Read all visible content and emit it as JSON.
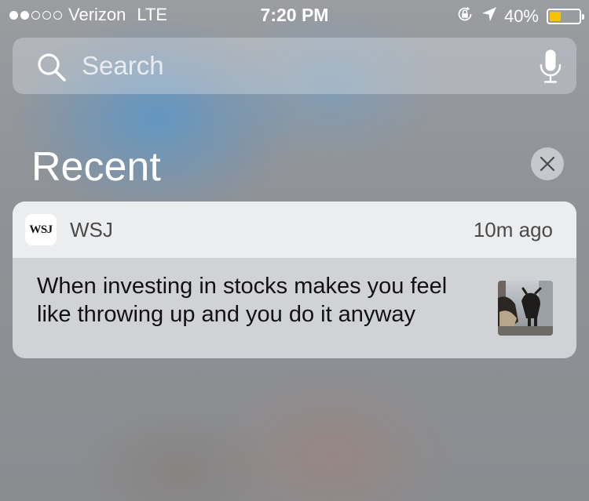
{
  "status_bar": {
    "signal_bars_filled": 2,
    "signal_bars_total": 5,
    "carrier": "Verizon",
    "network": "LTE",
    "time": "7:20 PM",
    "battery_percent": "40%",
    "battery_level": 0.4,
    "battery_color": "#f4c400",
    "icons": [
      "rotation-lock-icon",
      "location-arrow-icon",
      "battery-icon"
    ]
  },
  "search": {
    "placeholder": "Search",
    "icons": [
      "search-icon",
      "microphone-icon"
    ]
  },
  "recent": {
    "title": "Recent",
    "clear_icon": "close-icon"
  },
  "notification": {
    "app_icon_text": "WSJ",
    "app_name": "WSJ",
    "time": "10m ago",
    "message": "When investing in stocks makes you feel like throwing up and you do it anyway",
    "thumbnail": "bull-statue-thumbnail"
  }
}
